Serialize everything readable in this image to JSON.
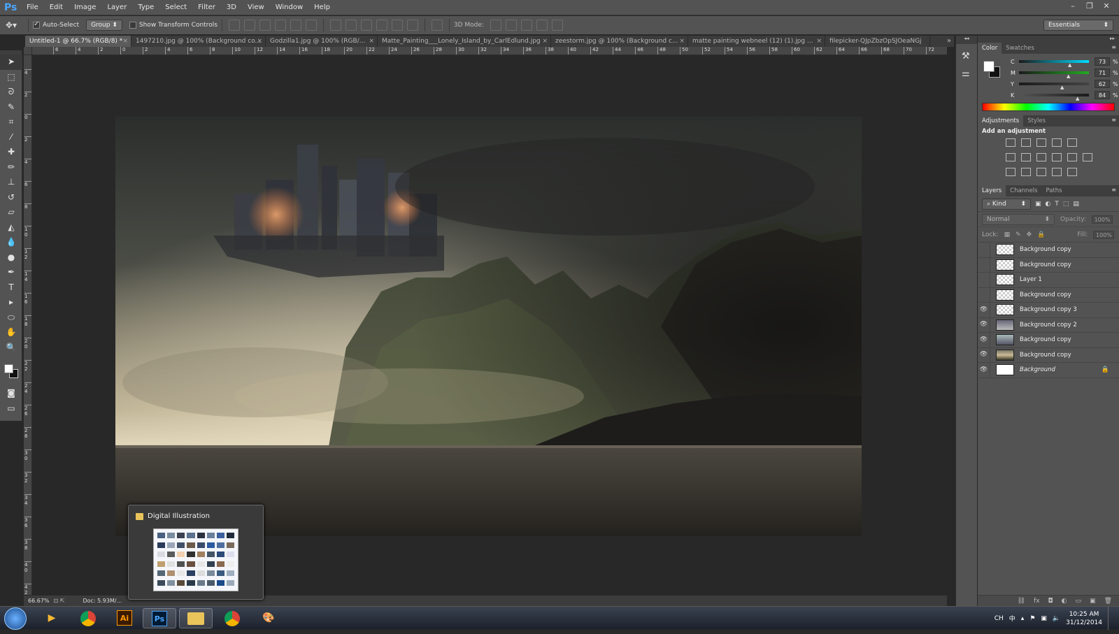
{
  "app": {
    "logo": "Ps"
  },
  "menu": [
    "File",
    "Edit",
    "Image",
    "Layer",
    "Type",
    "Select",
    "Filter",
    "3D",
    "View",
    "Window",
    "Help"
  ],
  "window_controls": [
    "–",
    "❐",
    "✕"
  ],
  "options": {
    "auto_select_label": "Auto-Select",
    "auto_select_checked": true,
    "auto_select_target": "Group",
    "show_transform_label": "Show Transform Controls",
    "show_transform_checked": false,
    "mode_3d_label": "3D Mode:",
    "workspace": "Essentials"
  },
  "tabs": [
    {
      "label": "Untitled-1 @ 66.7% (RGB/8) *",
      "active": true
    },
    {
      "label": "1497210.jpg @ 100% (Background co...",
      "active": false
    },
    {
      "label": "Godzilla1.jpg @ 100% (RGB/...",
      "active": false
    },
    {
      "label": "Matte_Painting___Lonely_Island_by_CarlEdlund.jpg",
      "active": false
    },
    {
      "label": "zeestorm.jpg @ 100% (Background c...",
      "active": false
    },
    {
      "label": "matte painting webneel (12) (1).jpg ...",
      "active": false
    },
    {
      "label": "filepicker-QJpZbzOpSJOeaNGj",
      "active": false
    }
  ],
  "tabs_more": "»",
  "ruler_h": [
    "6",
    "4",
    "2",
    "0",
    "2",
    "4",
    "6",
    "8",
    "10",
    "12",
    "14",
    "16",
    "18",
    "20",
    "22",
    "24",
    "26",
    "28",
    "30",
    "32",
    "34",
    "36",
    "38",
    "40",
    "42",
    "44",
    "46",
    "48",
    "50",
    "52",
    "54",
    "56",
    "58",
    "60",
    "62",
    "64",
    "66",
    "68",
    "70",
    "72",
    "74"
  ],
  "ruler_v": [
    "4",
    "2",
    "0",
    "2",
    "4",
    "6",
    "8",
    "1 0",
    "1 2",
    "1 4",
    "1 6",
    "1 8",
    "2 0",
    "2 2",
    "2 4",
    "2 6",
    "2 8",
    "3 0",
    "3 2",
    "3 4",
    "3 6",
    "3 8",
    "4 0",
    "4 2"
  ],
  "status": {
    "zoom": "66.67%",
    "doc": "Doc: 5.93M/..."
  },
  "thumbnail_popup": {
    "title": "Digital Illustration"
  },
  "color_panel": {
    "tabs": [
      "Color",
      "Swatches"
    ],
    "channels": [
      {
        "label": "C",
        "value": "73",
        "pct": 0.73
      },
      {
        "label": "M",
        "value": "71",
        "pct": 0.71
      },
      {
        "label": "Y",
        "value": "62",
        "pct": 0.62
      },
      {
        "label": "K",
        "value": "84",
        "pct": 0.84
      }
    ],
    "pct_sign": "%"
  },
  "adjustments": {
    "tabs": [
      "Adjustments",
      "Styles"
    ],
    "title": "Add an adjustment"
  },
  "layers_panel": {
    "tabs": [
      "Layers",
      "Channels",
      "Paths"
    ],
    "filter": "Kind",
    "blend_mode": "Normal",
    "opacity_label": "Opacity:",
    "opacity_value": "100%",
    "lock_label": "Lock:",
    "fill_label": "Fill:",
    "fill_value": "100%",
    "layers": [
      {
        "name": "Background copy",
        "visible": false
      },
      {
        "name": "Background copy",
        "visible": false
      },
      {
        "name": "Layer 1",
        "visible": false
      },
      {
        "name": "Background copy",
        "visible": false
      },
      {
        "name": "Background copy 3",
        "visible": true
      },
      {
        "name": "Background copy 2",
        "visible": true
      },
      {
        "name": "Background copy",
        "visible": true
      },
      {
        "name": "Background copy",
        "visible": true
      },
      {
        "name": "Background",
        "visible": true,
        "locked": true
      }
    ]
  },
  "taskbar": {
    "apps": [
      "media-player",
      "chrome",
      "illustrator",
      "photoshop",
      "explorer",
      "chrome",
      "paint"
    ],
    "ai_label": "Ai",
    "ps_label": "Ps",
    "lang": "CH",
    "time": "10:25 AM",
    "date": "31/12/2014"
  }
}
